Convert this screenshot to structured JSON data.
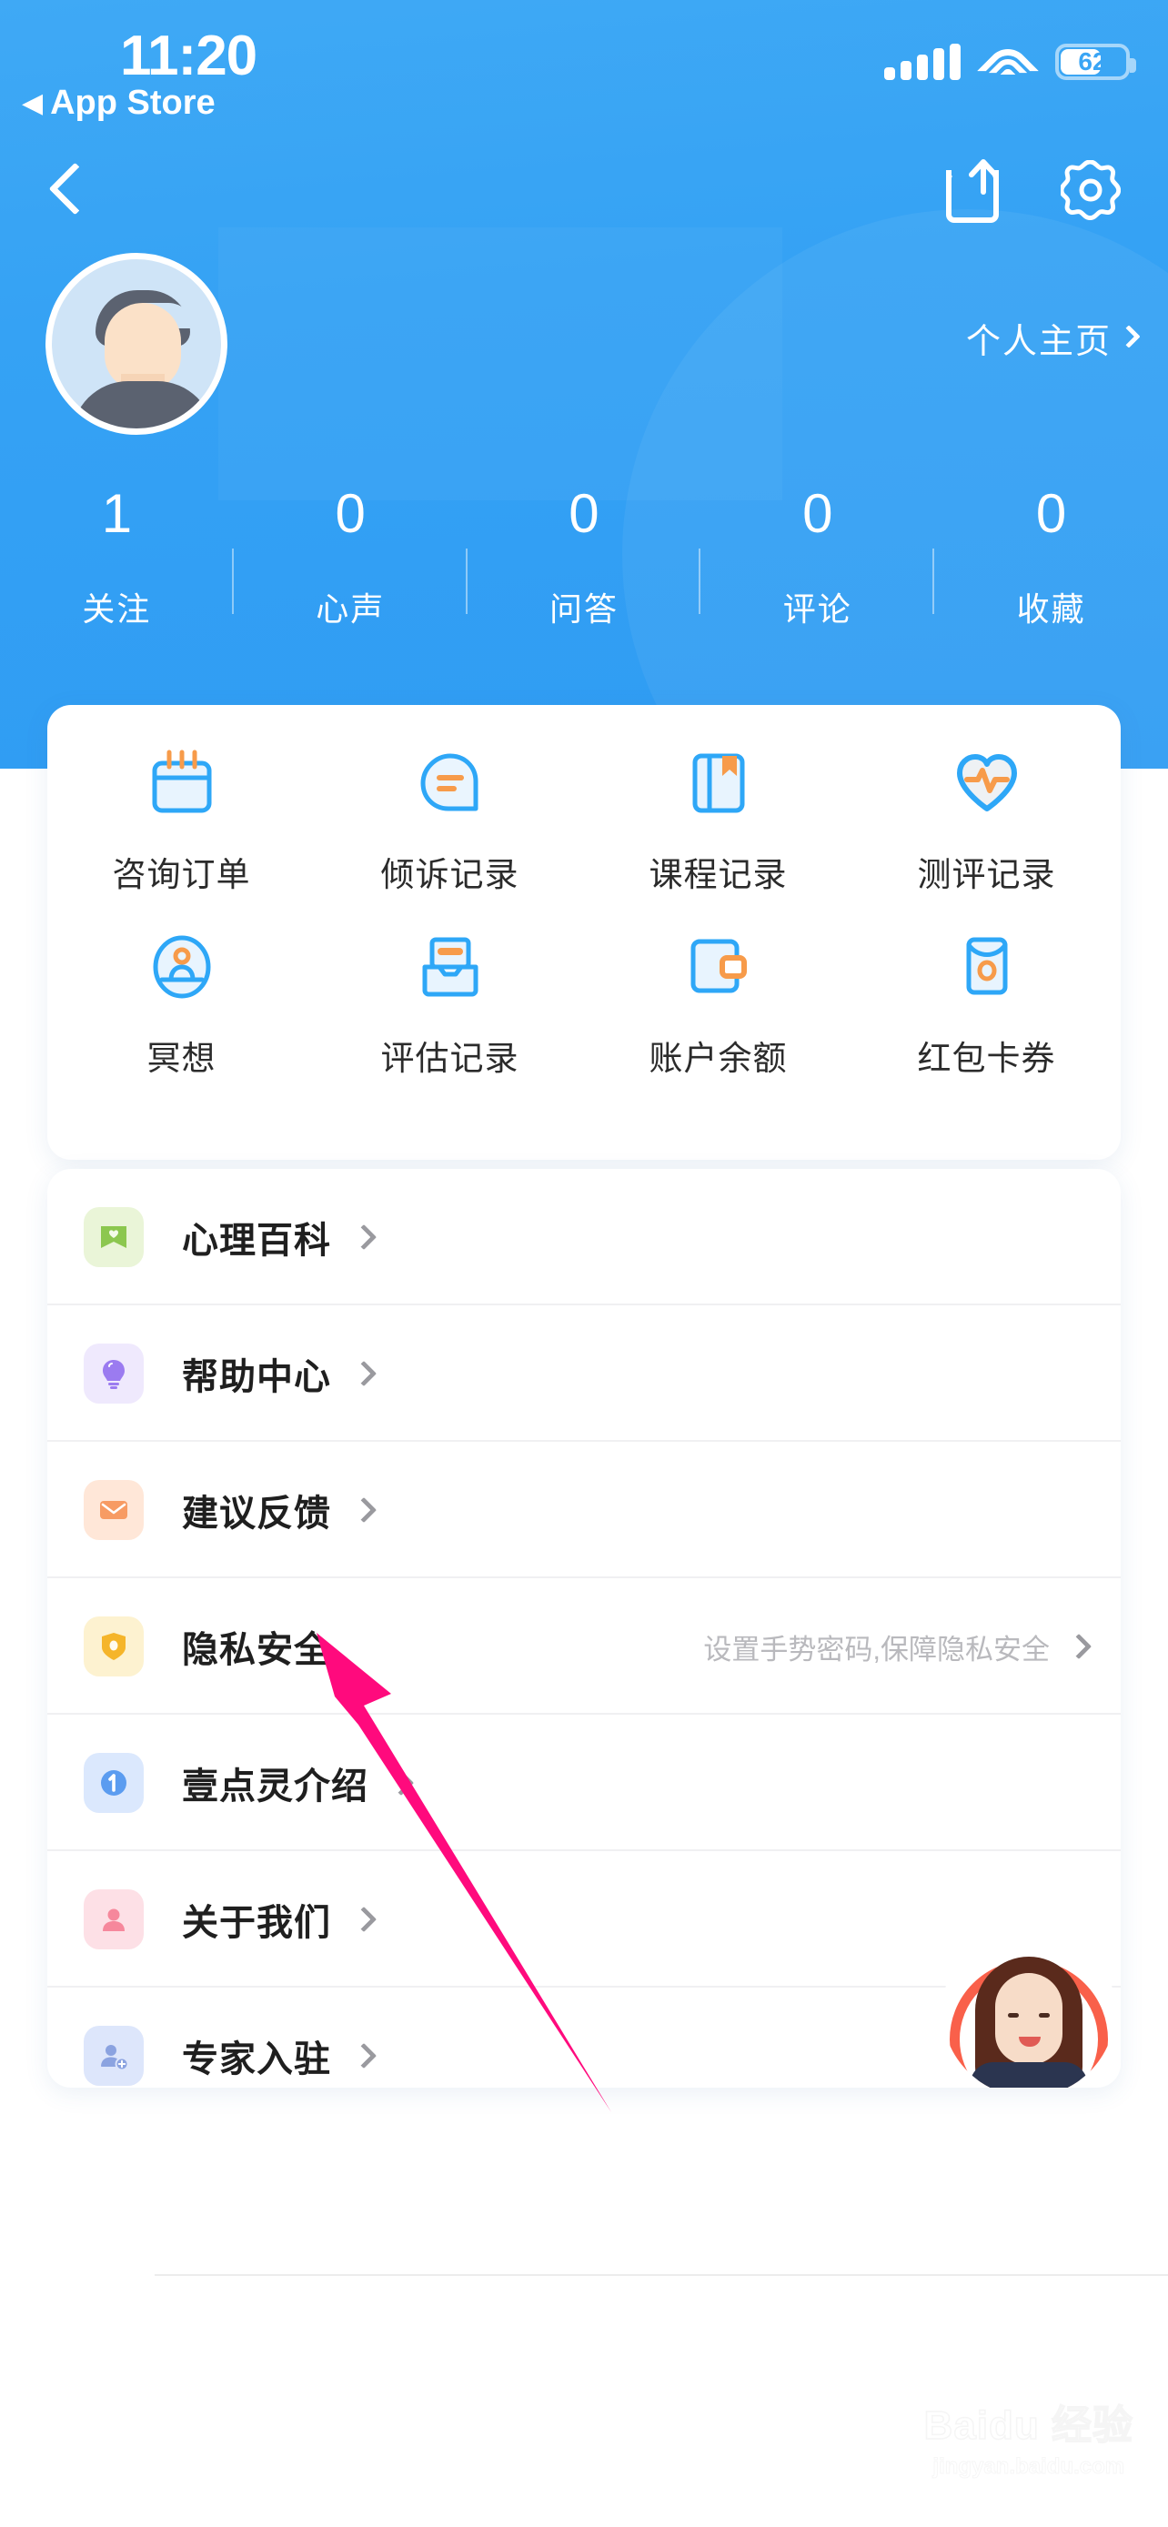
{
  "status_bar": {
    "time": "11:20",
    "back_to_app": "App Store",
    "back_triangle": "◀",
    "battery_percent": "62",
    "signal_icon": "signal-bars-icon",
    "wifi_icon": "wifi-icon",
    "battery_icon": "battery-icon"
  },
  "nav": {
    "back_icon": "back-chevron-icon",
    "share_icon": "share-icon",
    "settings_icon": "gear-icon"
  },
  "profile": {
    "avatar_icon": "user-avatar",
    "home_link_label": "个人主页",
    "home_link_chevron": "chevron-right-icon"
  },
  "stats": [
    {
      "value": "1",
      "label": "关注"
    },
    {
      "value": "0",
      "label": "心声"
    },
    {
      "value": "0",
      "label": "问答"
    },
    {
      "value": "0",
      "label": "评论"
    },
    {
      "value": "0",
      "label": "收藏"
    }
  ],
  "quick_grid": [
    {
      "label": "咨询订单",
      "icon": "calendar-icon"
    },
    {
      "label": "倾诉记录",
      "icon": "speech-bubble-icon"
    },
    {
      "label": "课程记录",
      "icon": "book-bookmark-icon"
    },
    {
      "label": "测评记录",
      "icon": "heart-pulse-icon"
    },
    {
      "label": "冥想",
      "icon": "meditation-icon"
    },
    {
      "label": "评估记录",
      "icon": "inbox-tray-icon"
    },
    {
      "label": "账户余额",
      "icon": "wallet-icon"
    },
    {
      "label": "红包卡券",
      "icon": "red-envelope-icon"
    }
  ],
  "menu_list": [
    {
      "label": "心理百科",
      "sub": "",
      "icon": "book-heart-icon",
      "icon_bg": "#eaf5d8",
      "icon_fg": "#8cc74f"
    },
    {
      "label": "帮助中心",
      "sub": "",
      "icon": "lightbulb-icon",
      "icon_bg": "#efe9fd",
      "icon_fg": "#9b7bf0"
    },
    {
      "label": "建议反馈",
      "sub": "",
      "icon": "envelope-icon",
      "icon_bg": "#ffe7d8",
      "icon_fg": "#f79b63"
    },
    {
      "label": "隐私安全",
      "sub": "设置手势密码,保障隐私安全",
      "icon": "shield-icon",
      "icon_bg": "#fdf2d0",
      "icon_fg": "#f5b52a"
    },
    {
      "label": "壹点灵介绍",
      "sub": "",
      "icon": "info-circle-icon",
      "icon_bg": "#dbe8fd",
      "icon_fg": "#5b9cf0"
    },
    {
      "label": "关于我们",
      "sub": "",
      "icon": "person-icon",
      "icon_bg": "#fde0e6",
      "icon_fg": "#f6889c"
    },
    {
      "label": "专家入驻",
      "sub": "",
      "icon": "person-add-icon",
      "icon_bg": "#dde6fb",
      "icon_fg": "#8ba3e0"
    }
  ],
  "expert_float": {
    "icon": "expert-avatar-floating"
  },
  "annotation": {
    "arrow_icon": "pink-pointer-arrow",
    "color": "#ff0a7d"
  },
  "watermark": {
    "main": "Baidu 经验",
    "sub": "jingyan.baidu.com"
  },
  "colors": {
    "header_blue": "#3aa5f5",
    "accent_orange": "#f79b4a",
    "icon_blue": "#2ea7f7",
    "text_primary": "#1f1f1f",
    "text_muted": "#b9b9bd"
  }
}
